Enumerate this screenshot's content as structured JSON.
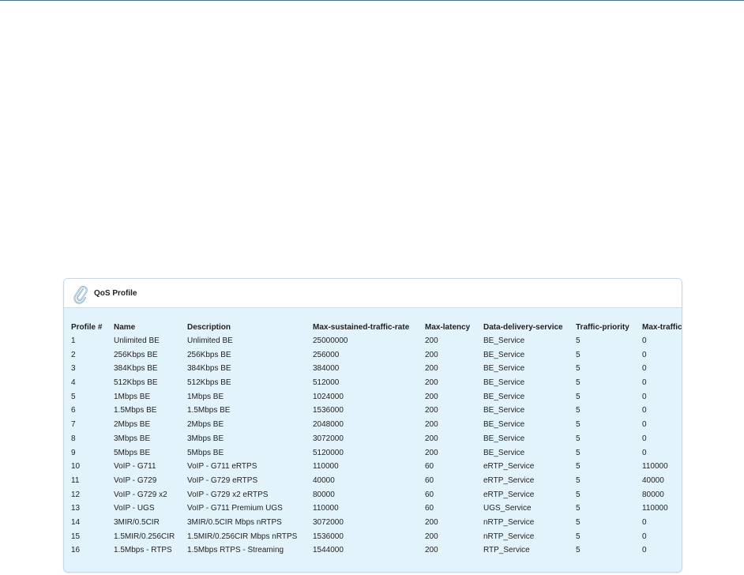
{
  "panel": {
    "title": "QoS Profile",
    "icon": "paperclip-icon"
  },
  "table": {
    "headers": [
      "Profile #",
      "Name",
      "Description",
      "Max-sustained-traffic-rate",
      "Max-latency",
      "Data-delivery-service",
      "Traffic-priority",
      "Max-traffic"
    ],
    "rows": [
      [
        "1",
        "Unlimited BE",
        "Unlimited BE",
        "25000000",
        "200",
        "BE_Service",
        "5",
        "0"
      ],
      [
        "2",
        "256Kbps BE",
        "256Kbps BE",
        "256000",
        "200",
        "BE_Service",
        "5",
        "0"
      ],
      [
        "3",
        "384Kbps BE",
        "384Kbps BE",
        "384000",
        "200",
        "BE_Service",
        "5",
        "0"
      ],
      [
        "4",
        "512Kbps BE",
        "512Kbps BE",
        "512000",
        "200",
        "BE_Service",
        "5",
        "0"
      ],
      [
        "5",
        "1Mbps BE",
        "1Mbps BE",
        "1024000",
        "200",
        "BE_Service",
        "5",
        "0"
      ],
      [
        "6",
        "1.5Mbps BE",
        "1.5Mbps BE",
        "1536000",
        "200",
        "BE_Service",
        "5",
        "0"
      ],
      [
        "7",
        "2Mbps BE",
        "2Mbps BE",
        "2048000",
        "200",
        "BE_Service",
        "5",
        "0"
      ],
      [
        "8",
        "3Mbps BE",
        "3Mbps BE",
        "3072000",
        "200",
        "BE_Service",
        "5",
        "0"
      ],
      [
        "9",
        "5Mbps BE",
        "5Mbps BE",
        "5120000",
        "200",
        "BE_Service",
        "5",
        "0"
      ],
      [
        "10",
        "VoIP - G711",
        "VoIP - G711 eRTPS",
        "110000",
        "60",
        "eRTP_Service",
        "5",
        "110000"
      ],
      [
        "11",
        "VoIP - G729",
        "VoIP - G729 eRTPS",
        "40000",
        "60",
        "eRTP_Service",
        "5",
        "40000"
      ],
      [
        "12",
        "VoIP - G729 x2",
        "VoIP - G729 x2 eRTPS",
        "80000",
        "60",
        "eRTP_Service",
        "5",
        "80000"
      ],
      [
        "13",
        "VoIP - UGS",
        "VoIP - G711 Premium UGS",
        "110000",
        "60",
        "UGS_Service",
        "5",
        "110000"
      ],
      [
        "14",
        "3MIR/0.5CIR",
        "3MIR/0.5CIR Mbps nRTPS",
        "3072000",
        "200",
        "nRTP_Service",
        "5",
        "0"
      ],
      [
        "15",
        "1.5MIR/0.256CIR",
        "1.5MIR/0.256CIR Mbps nRTPS",
        "1536000",
        "200",
        "nRTP_Service",
        "5",
        "0"
      ],
      [
        "16",
        "1.5Mbps - RTPS",
        "1.5Mbps RTPS - Streaming",
        "1544000",
        "200",
        "RTP_Service",
        "5",
        "0"
      ]
    ]
  }
}
